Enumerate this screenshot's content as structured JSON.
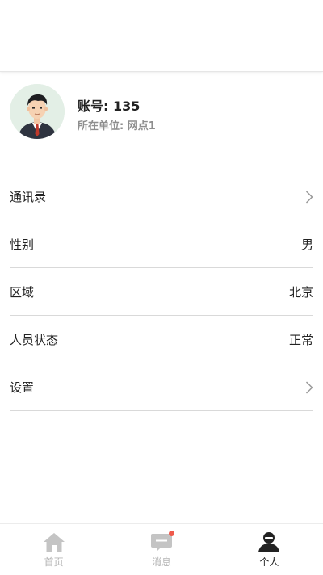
{
  "header": {},
  "profile": {
    "account": "账号: 135",
    "unit": "所在单位: 网点1"
  },
  "menu": [
    {
      "label": "通讯录",
      "value": "",
      "action": "chevron"
    },
    {
      "label": "性别",
      "value": "男",
      "action": "none"
    },
    {
      "label": "区域",
      "value": "北京",
      "action": "none"
    },
    {
      "label": "人员状态",
      "value": "正常",
      "action": "none"
    },
    {
      "label": "设置",
      "value": "",
      "action": "chevron"
    }
  ],
  "tabbar": {
    "items": [
      {
        "label": "首页",
        "icon": "home-icon",
        "active": false
      },
      {
        "label": "消息",
        "icon": "message-icon",
        "active": false,
        "badge": true
      },
      {
        "label": "个人",
        "icon": "person-icon",
        "active": true
      }
    ]
  },
  "colors": {
    "badge": "#ef5a4c",
    "inactive_tab": "#b5b5b5",
    "active_tab": "#222222",
    "divider": "#d9d9d9"
  }
}
